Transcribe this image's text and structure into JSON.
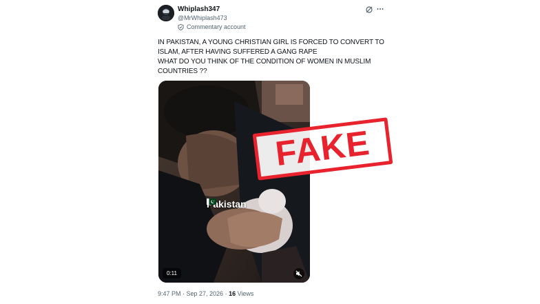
{
  "tweet": {
    "display_name": "Whiplash347",
    "handle": "@MrWhiplash473",
    "account_label": "Commentary account",
    "text_lines": [
      "IN PAKISTAN, A YOUNG CHRISTIAN GIRL IS FORCED TO CONVERT TO",
      "ISLAM, AFTER HAVING SUFFERED A GANG RAPE",
      "WHAT DO YOU THINK OF THE CONDITION OF WOMEN IN MUSLIM",
      "COUNTRIES ??"
    ],
    "timestamp": "9:47 PM · Sep 27, 2026 · ",
    "views_count": "16",
    "views_label": " Views"
  },
  "video": {
    "overlay_text": "Pakistan",
    "duration": "0:11"
  },
  "stamp": {
    "text": "FAKE",
    "color": "#e8232e"
  },
  "icons": {
    "grok": "grok-icon",
    "more": "more-icon",
    "commentary": "shield-icon",
    "mute": "mute-icon"
  }
}
